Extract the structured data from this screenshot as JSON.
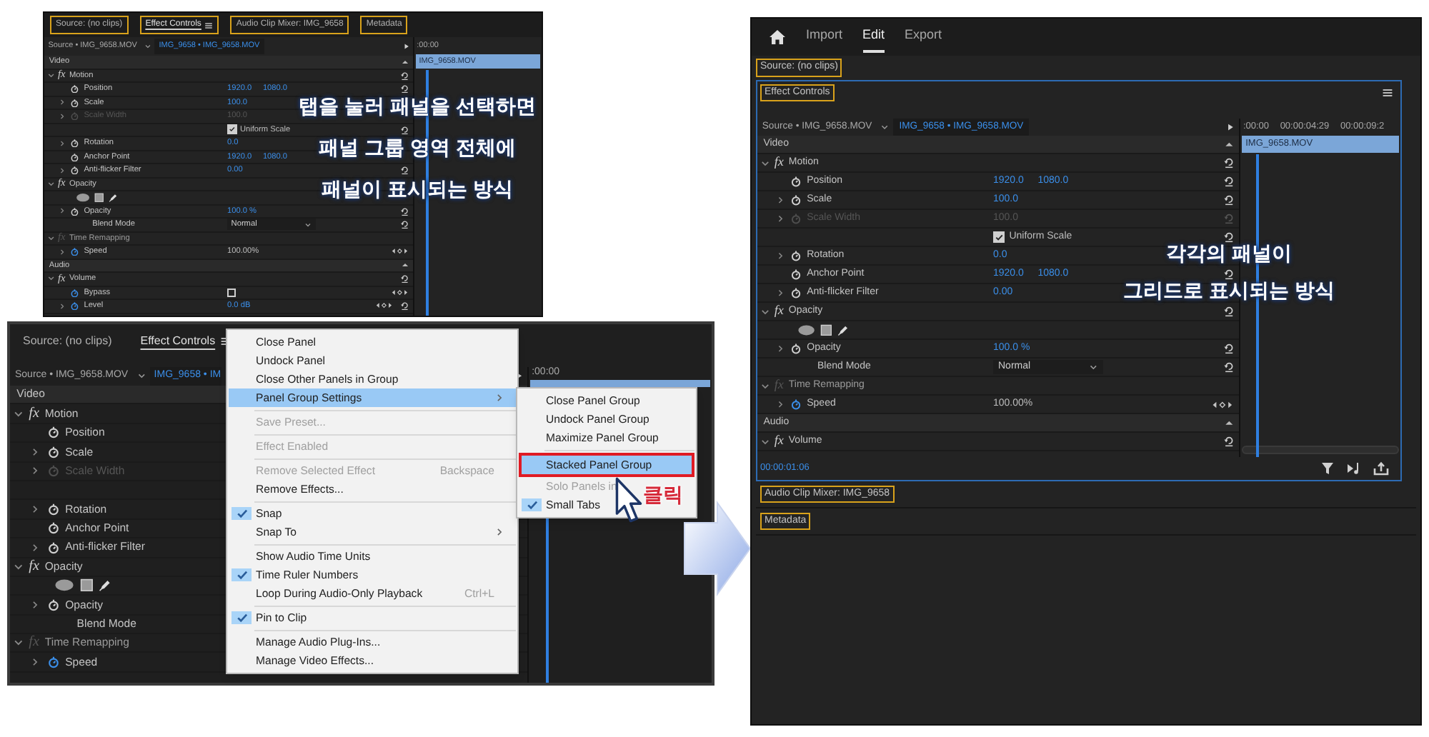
{
  "before": {
    "tabs": [
      {
        "label": "Source: (no clips)",
        "selected": false,
        "highlighted": true,
        "menu": false
      },
      {
        "label": "Effect Controls",
        "selected": true,
        "highlighted": true,
        "menu": true
      },
      {
        "label": "Audio Clip Mixer: IMG_9658",
        "selected": false,
        "highlighted": true,
        "menu": false
      },
      {
        "label": "Metadata",
        "selected": false,
        "highlighted": true,
        "menu": false
      }
    ],
    "source": "Source • IMG_9658.MOV",
    "sequence": "IMG_9658 • IMG_9658.MOV",
    "timecodes": [
      ":00:00"
    ],
    "clip": "IMG_9658.MOV",
    "rows": [
      {
        "kind": "section",
        "label": "Video"
      },
      {
        "kind": "effect",
        "badge": "fx",
        "label": "Motion",
        "enabled": true,
        "reset": true
      },
      {
        "kind": "property",
        "label": "Position",
        "expandable": false,
        "disabled": false,
        "keyframed": false,
        "keyframe_nav": false,
        "values": [
          "1920.0",
          "1080.0"
        ],
        "reset": true
      },
      {
        "kind": "property",
        "label": "Scale",
        "expandable": true,
        "disabled": false,
        "keyframed": false,
        "keyframe_nav": false,
        "values": [
          "100.0"
        ],
        "reset": false
      },
      {
        "kind": "property",
        "label": "Scale Width",
        "expandable": true,
        "disabled": true,
        "keyframed": false,
        "keyframe_nav": false,
        "values": [
          "100.0"
        ],
        "reset": false
      },
      {
        "kind": "checkbox",
        "label": "Uniform Scale",
        "checked": true,
        "reset": true
      },
      {
        "kind": "property",
        "label": "Rotation",
        "expandable": true,
        "disabled": false,
        "keyframed": false,
        "keyframe_nav": false,
        "values": [
          "0.0"
        ],
        "reset": false
      },
      {
        "kind": "property",
        "label": "Anchor Point",
        "expandable": false,
        "disabled": false,
        "keyframed": false,
        "keyframe_nav": false,
        "values": [
          "1920.0",
          "1080.0"
        ],
        "reset": false
      },
      {
        "kind": "property",
        "label": "Anti-flicker Filter",
        "expandable": true,
        "disabled": false,
        "keyframed": false,
        "keyframe_nav": false,
        "values": [
          "0.00"
        ],
        "reset": true
      },
      {
        "kind": "effect",
        "badge": "fx",
        "label": "Opacity",
        "enabled": true,
        "reset": false
      },
      {
        "kind": "masks"
      },
      {
        "kind": "property",
        "label": "Opacity",
        "expandable": true,
        "disabled": false,
        "keyframed": false,
        "keyframe_nav": false,
        "values": [
          "100.0 %"
        ],
        "reset": true
      },
      {
        "kind": "dropdown",
        "label": "Blend Mode",
        "value": "Normal",
        "reset": true
      },
      {
        "kind": "effect",
        "badge": "fx",
        "label": "Time Remapping",
        "enabled": false,
        "reset": false
      },
      {
        "kind": "property",
        "label": "Speed",
        "expandable": true,
        "disabled": false,
        "keyframed": true,
        "keyframe_nav": true,
        "readout": "100.00%",
        "reset": false
      },
      {
        "kind": "section",
        "label": "Audio"
      },
      {
        "kind": "effect",
        "badge": "fx",
        "label": "Volume",
        "enabled": true,
        "reset": true
      },
      {
        "kind": "property",
        "label": "Bypass",
        "expandable": false,
        "disabled": false,
        "keyframed": true,
        "keyframe_nav": true,
        "checked": false,
        "reset": false
      },
      {
        "kind": "property",
        "label": "Level",
        "expandable": true,
        "disabled": false,
        "keyframed": true,
        "keyframe_nav": true,
        "values": [
          "0.0 dB"
        ],
        "reset": true
      }
    ],
    "annotation": [
      "**탭**을 눌러 **패널**을 선택하면",
      "패널 그룹 영역 전체에",
      "패널이 표시되는 방식"
    ]
  },
  "during": {
    "tabs": [
      {
        "label": "Source: (no clips)",
        "selected": false,
        "highlighted": false,
        "menu": false
      },
      {
        "label": "Effect Controls",
        "selected": true,
        "highlighted": false,
        "menu": true
      }
    ],
    "source": "Source • IMG_9658.MOV",
    "sequence": "IMG_9658 • IM",
    "timecodes": [
      ":00:00"
    ],
    "rows": [
      {
        "kind": "section",
        "label": "Video"
      },
      {
        "kind": "effect",
        "badge": "fx",
        "label": "Motion",
        "enabled": true,
        "reset": false
      },
      {
        "kind": "property",
        "label": "Position",
        "expandable": false,
        "disabled": false,
        "keyframed": false,
        "keyframe_nav": false,
        "reset": false
      },
      {
        "kind": "property",
        "label": "Scale",
        "expandable": true,
        "disabled": false,
        "keyframed": false,
        "keyframe_nav": false,
        "reset": false
      },
      {
        "kind": "property",
        "label": "Scale Width",
        "expandable": true,
        "disabled": true,
        "keyframed": false,
        "keyframe_nav": false,
        "reset": false
      },
      {
        "kind": "spacer"
      },
      {
        "kind": "property",
        "label": "Rotation",
        "expandable": true,
        "disabled": false,
        "keyframed": false,
        "keyframe_nav": false,
        "reset": false
      },
      {
        "kind": "property",
        "label": "Anchor Point",
        "expandable": false,
        "disabled": false,
        "keyframed": false,
        "keyframe_nav": false,
        "reset": false
      },
      {
        "kind": "property",
        "label": "Anti-flicker Filter",
        "expandable": true,
        "disabled": false,
        "keyframed": false,
        "keyframe_nav": false,
        "reset": false
      },
      {
        "kind": "effect",
        "badge": "fx",
        "label": "Opacity",
        "enabled": true,
        "reset": false
      },
      {
        "kind": "masks"
      },
      {
        "kind": "property",
        "label": "Opacity",
        "expandable": true,
        "disabled": false,
        "keyframed": false,
        "keyframe_nav": false,
        "reset": false
      },
      {
        "kind": "dropdown",
        "label": "Blend Mode",
        "reset": false
      },
      {
        "kind": "effect",
        "badge": "fx",
        "label": "Time Remapping",
        "enabled": false,
        "reset": false
      },
      {
        "kind": "property",
        "label": "Speed",
        "expandable": true,
        "disabled": false,
        "keyframed": true,
        "keyframe_nav": false,
        "reset": false
      }
    ]
  },
  "context_menu": {
    "items": [
      {
        "kind": "item",
        "label": "Close Panel",
        "checked": false,
        "disabled": false,
        "highlighted": false,
        "submenu": false
      },
      {
        "kind": "item",
        "label": "Undock Panel",
        "checked": false,
        "disabled": false,
        "highlighted": false,
        "submenu": false
      },
      {
        "kind": "item",
        "label": "Close Other Panels in Group",
        "checked": false,
        "disabled": false,
        "highlighted": false,
        "submenu": false
      },
      {
        "kind": "item",
        "label": "Panel Group Settings",
        "checked": false,
        "disabled": false,
        "highlighted": true,
        "submenu": true
      },
      {
        "kind": "separator"
      },
      {
        "kind": "item",
        "label": "Save Preset...",
        "checked": false,
        "disabled": true,
        "highlighted": false,
        "submenu": false
      },
      {
        "kind": "separator"
      },
      {
        "kind": "item",
        "label": "Effect Enabled",
        "checked": false,
        "disabled": true,
        "highlighted": false,
        "submenu": false
      },
      {
        "kind": "separator"
      },
      {
        "kind": "item",
        "label": "Remove Selected Effect",
        "shortcut": "Backspace",
        "checked": false,
        "disabled": true,
        "highlighted": false,
        "submenu": false
      },
      {
        "kind": "item",
        "label": "Remove Effects...",
        "checked": false,
        "disabled": false,
        "highlighted": false,
        "submenu": false
      },
      {
        "kind": "separator"
      },
      {
        "kind": "item",
        "label": "Snap",
        "checked": true,
        "disabled": false,
        "highlighted": false,
        "submenu": false
      },
      {
        "kind": "item",
        "label": "Snap To",
        "checked": false,
        "disabled": false,
        "highlighted": false,
        "submenu": true
      },
      {
        "kind": "separator"
      },
      {
        "kind": "item",
        "label": "Show Audio Time Units",
        "checked": false,
        "disabled": false,
        "highlighted": false,
        "submenu": false
      },
      {
        "kind": "item",
        "label": "Time Ruler Numbers",
        "checked": true,
        "disabled": false,
        "highlighted": false,
        "submenu": false
      },
      {
        "kind": "item",
        "label": "Loop During Audio-Only Playback",
        "shortcut": "Ctrl+L",
        "checked": false,
        "disabled": false,
        "highlighted": false,
        "submenu": false
      },
      {
        "kind": "separator"
      },
      {
        "kind": "item",
        "label": "Pin to Clip",
        "checked": true,
        "disabled": false,
        "highlighted": false,
        "submenu": false
      },
      {
        "kind": "separator"
      },
      {
        "kind": "item",
        "label": "Manage Audio Plug-Ins...",
        "checked": false,
        "disabled": false,
        "highlighted": false,
        "submenu": false
      },
      {
        "kind": "item",
        "label": "Manage Video Effects...",
        "checked": false,
        "disabled": false,
        "highlighted": false,
        "submenu": false
      }
    ]
  },
  "submenu": {
    "items": [
      {
        "kind": "item",
        "label": "Close Panel Group",
        "checked": false,
        "disabled": false,
        "highlighted": false,
        "outlined": false
      },
      {
        "kind": "item",
        "label": "Undock Panel Group",
        "checked": false,
        "disabled": false,
        "highlighted": false,
        "outlined": false
      },
      {
        "kind": "item",
        "label": "Maximize Panel Group",
        "checked": false,
        "disabled": false,
        "highlighted": false,
        "outlined": false
      },
      {
        "kind": "separator"
      },
      {
        "kind": "item",
        "label": "Stacked Panel Group",
        "checked": false,
        "disabled": false,
        "highlighted": true,
        "outlined": true
      },
      {
        "kind": "item",
        "label": "Solo Panels in",
        "checked": false,
        "disabled": true,
        "highlighted": false,
        "outlined": false
      },
      {
        "kind": "item",
        "label": "Small Tabs",
        "checked": true,
        "disabled": false,
        "highlighted": false,
        "outlined": false
      }
    ]
  },
  "click_label": "클릭",
  "after": {
    "workspace_tabs": [
      {
        "label": "Import",
        "selected": false
      },
      {
        "label": "Edit",
        "selected": true
      },
      {
        "label": "Export",
        "selected": false
      }
    ],
    "source_tab": {
      "label": "Source: (no clips)",
      "highlighted": true
    },
    "effect_controls": {
      "tab": {
        "label": "Effect Controls",
        "highlighted": true
      },
      "source": "Source • IMG_9658.MOV",
      "sequence": "IMG_9658 • IMG_9658.MOV",
      "timecodes": [
        ":00:00",
        "00:00:04:29",
        "00:00:09:2"
      ],
      "clip": "IMG_9658.MOV",
      "rows": [
        {
          "kind": "section",
          "label": "Video"
        },
        {
          "kind": "effect",
          "badge": "fx",
          "label": "Motion",
          "enabled": true,
          "reset": true
        },
        {
          "kind": "property",
          "label": "Position",
          "expandable": false,
          "disabled": false,
          "keyframed": false,
          "keyframe_nav": false,
          "values": [
            "1920.0",
            "1080.0"
          ],
          "reset": true
        },
        {
          "kind": "property",
          "label": "Scale",
          "expandable": true,
          "disabled": false,
          "keyframed": false,
          "keyframe_nav": false,
          "values": [
            "100.0"
          ],
          "reset": true
        },
        {
          "kind": "property",
          "label": "Scale Width",
          "expandable": true,
          "disabled": true,
          "keyframed": false,
          "keyframe_nav": false,
          "values": [
            "100.0"
          ],
          "reset": true
        },
        {
          "kind": "checkbox",
          "label": "Uniform Scale",
          "checked": true,
          "reset": true
        },
        {
          "kind": "property",
          "label": "Rotation",
          "expandable": true,
          "disabled": false,
          "keyframed": false,
          "keyframe_nav": false,
          "values": [
            "0.0"
          ],
          "reset": false
        },
        {
          "kind": "property",
          "label": "Anchor Point",
          "expandable": false,
          "disabled": false,
          "keyframed": false,
          "keyframe_nav": false,
          "values": [
            "1920.0",
            "1080.0"
          ],
          "reset": true
        },
        {
          "kind": "property",
          "label": "Anti-flicker Filter",
          "expandable": true,
          "disabled": false,
          "keyframed": false,
          "keyframe_nav": false,
          "values": [
            "0.00"
          ],
          "reset": false
        },
        {
          "kind": "effect",
          "badge": "fx",
          "label": "Opacity",
          "enabled": true,
          "reset": true
        },
        {
          "kind": "masks"
        },
        {
          "kind": "property",
          "label": "Opacity",
          "expandable": true,
          "disabled": false,
          "keyframed": false,
          "keyframe_nav": false,
          "values": [
            "100.0 %"
          ],
          "reset": true
        },
        {
          "kind": "dropdown",
          "label": "Blend Mode",
          "value": "Normal",
          "reset": true
        },
        {
          "kind": "effect",
          "badge": "fx",
          "label": "Time Remapping",
          "enabled": false,
          "reset": false
        },
        {
          "kind": "property",
          "label": "Speed",
          "expandable": true,
          "disabled": false,
          "keyframed": true,
          "keyframe_nav": true,
          "readout": "100.00%",
          "reset": false
        },
        {
          "kind": "section",
          "label": "Audio"
        },
        {
          "kind": "effect",
          "badge": "fx",
          "label": "Volume",
          "enabled": true,
          "reset": true
        }
      ],
      "current_time": "00:00:01:06"
    },
    "collapsed_tabs": [
      {
        "label": "Audio Clip Mixer: IMG_9658",
        "highlighted": true
      },
      {
        "label": "Metadata",
        "highlighted": true
      }
    ],
    "annotation": [
      "**각각**의 **패널**이",
      "그리드로 표시되는 방식"
    ]
  }
}
